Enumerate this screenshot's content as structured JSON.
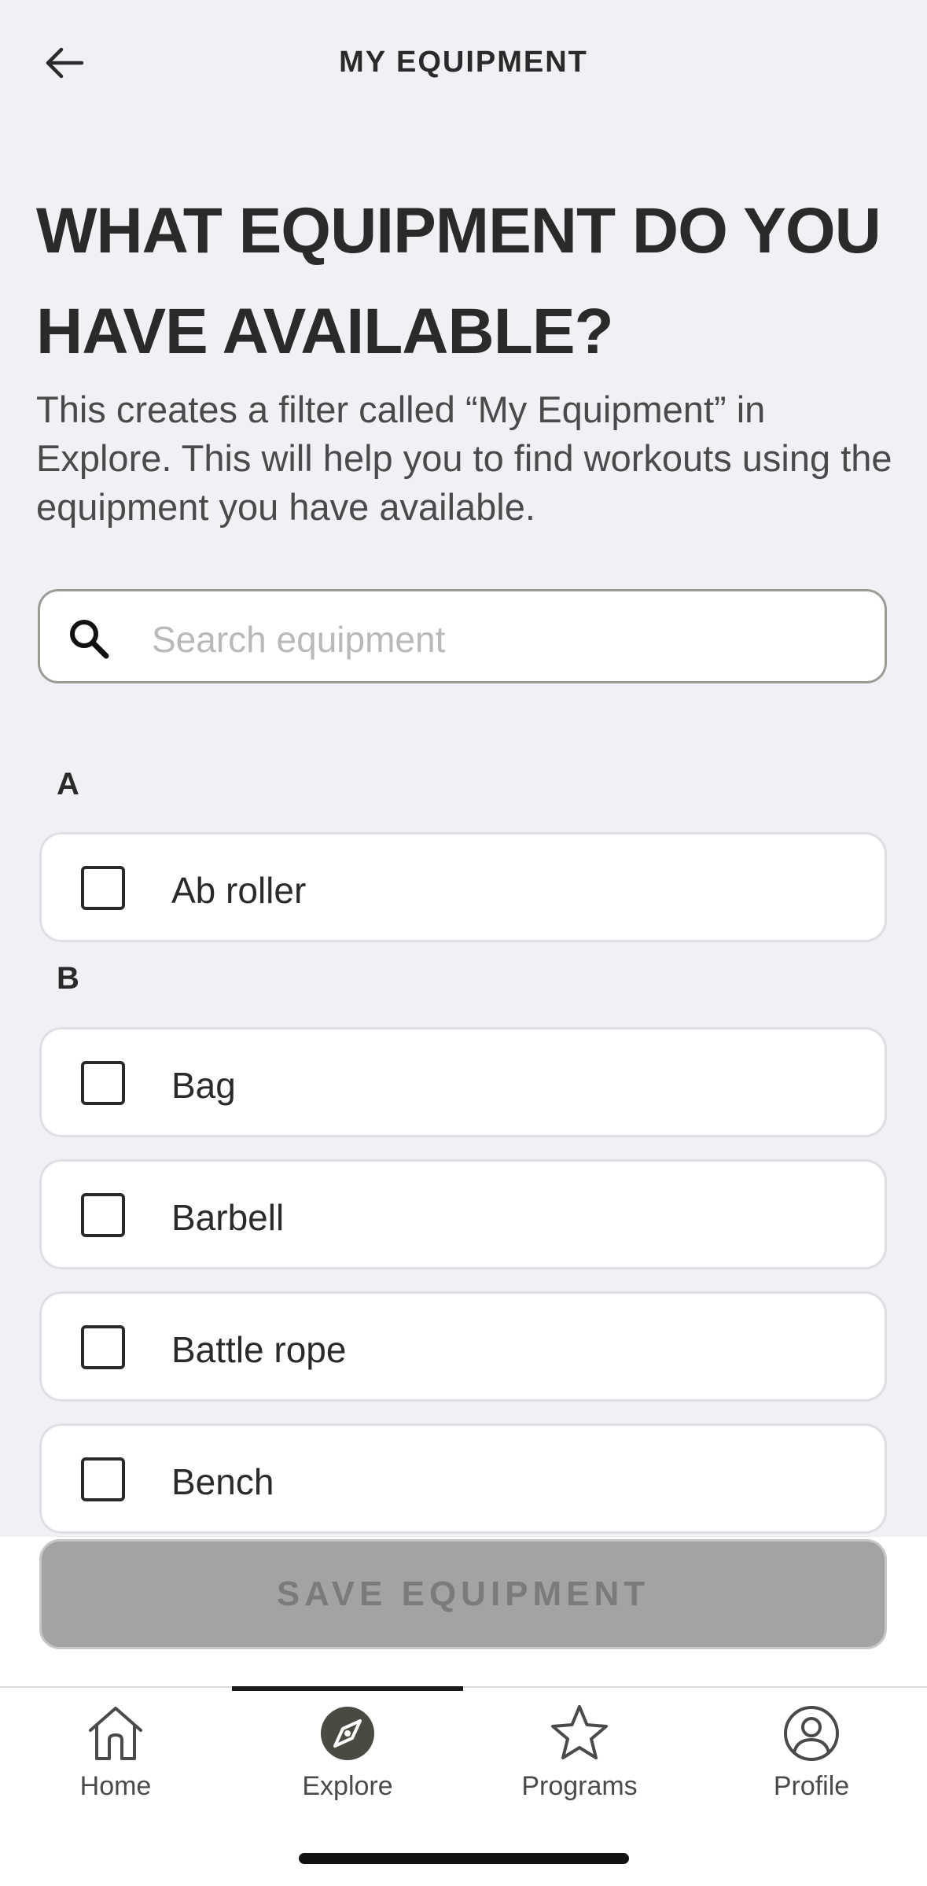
{
  "header": {
    "title": "MY EQUIPMENT",
    "back_icon": "arrow-left-icon"
  },
  "intro": {
    "headline": "WHAT EQUIPMENT DO YOU HAVE AVAILABLE?",
    "description": "This creates a filter called “My Equipment” in Explore. This will help you to find workouts using the equipment you have available."
  },
  "search": {
    "placeholder": "Search equipment",
    "value": "",
    "icon": "search-icon"
  },
  "sections": [
    {
      "letter": "A",
      "items": [
        {
          "label": "Ab roller",
          "checked": false
        }
      ]
    },
    {
      "letter": "B",
      "items": [
        {
          "label": "Bag",
          "checked": false
        },
        {
          "label": "Barbell",
          "checked": false
        },
        {
          "label": "Battle rope",
          "checked": false
        },
        {
          "label": "Bench",
          "checked": false
        }
      ]
    }
  ],
  "save_button": {
    "label": "SAVE EQUIPMENT",
    "enabled": false
  },
  "tabbar": {
    "active": "Explore",
    "tabs": [
      {
        "label": "Home",
        "icon": "home-icon"
      },
      {
        "label": "Explore",
        "icon": "compass-icon"
      },
      {
        "label": "Programs",
        "icon": "star-icon"
      },
      {
        "label": "Profile",
        "icon": "profile-icon"
      }
    ]
  },
  "colors": {
    "background": "#f1f1f5",
    "text": "#2a2a2a",
    "disabled_button": "#a3a3a3",
    "active_tab_icon": "#4a4a42"
  }
}
